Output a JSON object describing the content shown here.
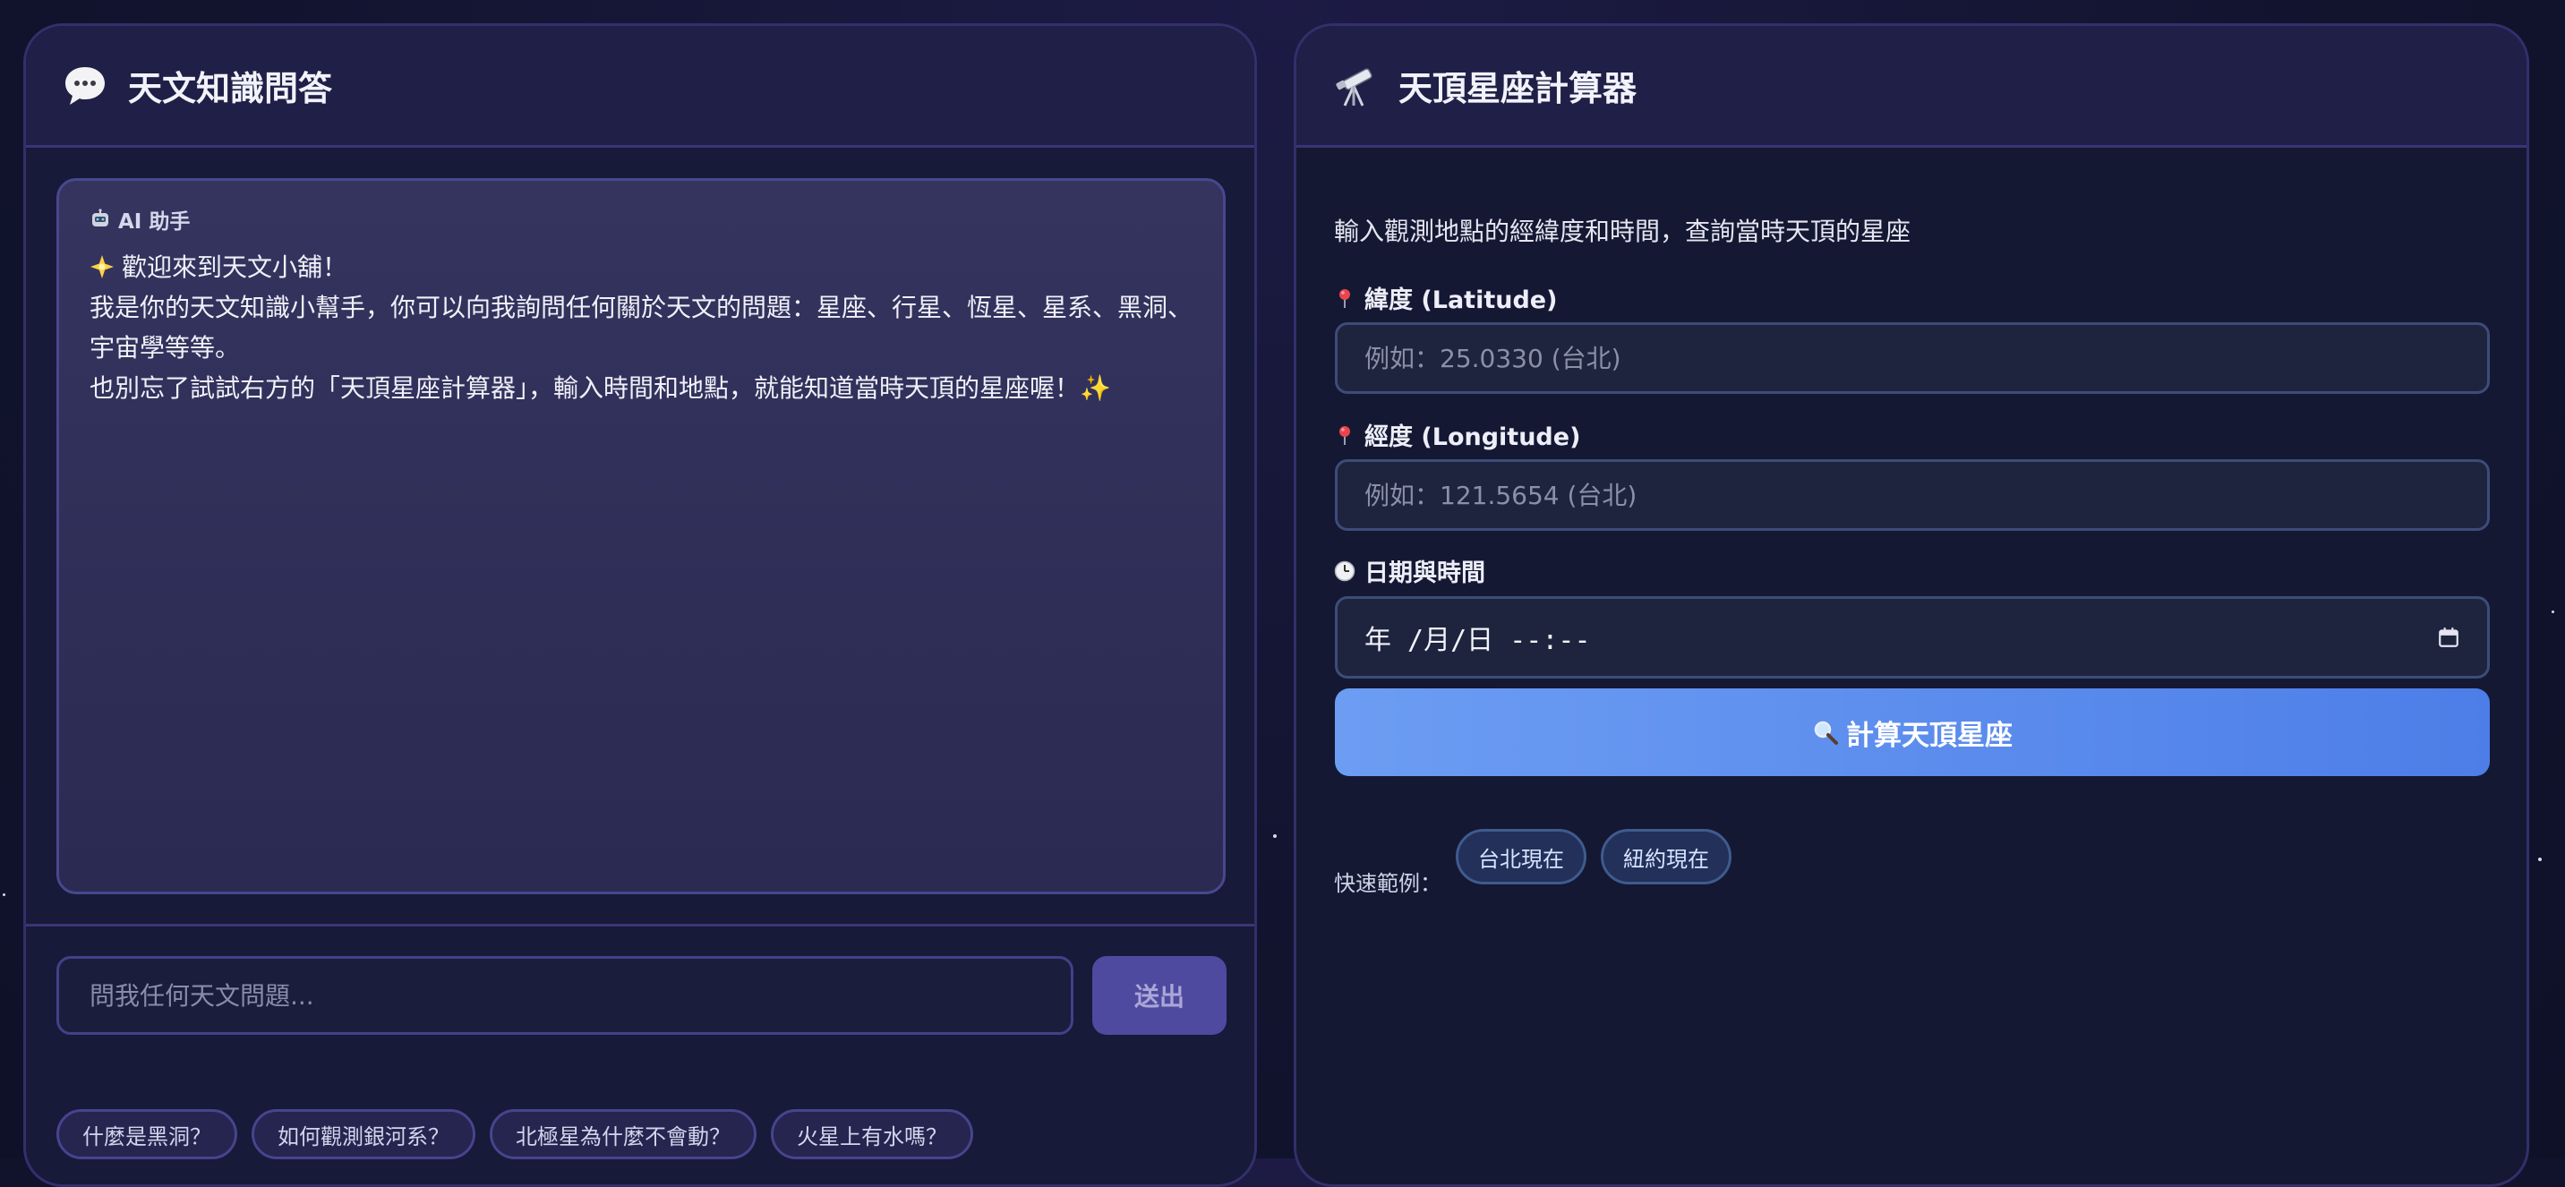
{
  "colors": {
    "background": "#12142f",
    "panel_border": "#332f6b",
    "send_button": "#4e4aa0",
    "calc_button_start": "#6c9df3",
    "calc_button_end": "#4d7ee8"
  },
  "chat_panel": {
    "icon": "speech-bubble-icon",
    "title": "天文知識問答",
    "message": {
      "sender_icon": "robot-icon",
      "sender": "AI 助手",
      "greeting_icon": "glowing-star-icon",
      "lines": [
        "歡迎來到天文小舖！",
        "我是你的天文知識小幫手，你可以向我詢問任何關於天文的問題：星座、行星、恆星、星系、黑洞、",
        "宇宙學等等。",
        "也別忘了試試右方的「天頂星座計算器」，輸入時間和地點，就能知道當時天頂的星座喔！",
        "✨"
      ]
    },
    "input_placeholder": "問我任何天文問題...",
    "send_label": "送出",
    "suggestions": [
      "什麼是黑洞？",
      "如何觀測銀河系？",
      "北極星為什麼不會動？",
      "火星上有水嗎？"
    ]
  },
  "calculator_panel": {
    "icon": "telescope-icon",
    "title": "天頂星座計算器",
    "description": "輸入觀測地點的經緯度和時間，查詢當時天頂的星座",
    "latitude": {
      "icon": "pin-icon",
      "label": "緯度 (Latitude)",
      "placeholder": "例如：25.0330 (台北)"
    },
    "longitude": {
      "icon": "pin-icon",
      "label": "經度 (Longitude)",
      "placeholder": "例如：121.5654 (台北)"
    },
    "datetime": {
      "icon": "clock-icon",
      "label": "日期與時間",
      "value": "年 /月/日 --:--"
    },
    "calc_icon": "magnifier-icon",
    "calc_label": "計算天頂星座",
    "quick_label": "快速範例：",
    "quick_examples": [
      "台北現在",
      "紐約現在"
    ]
  }
}
